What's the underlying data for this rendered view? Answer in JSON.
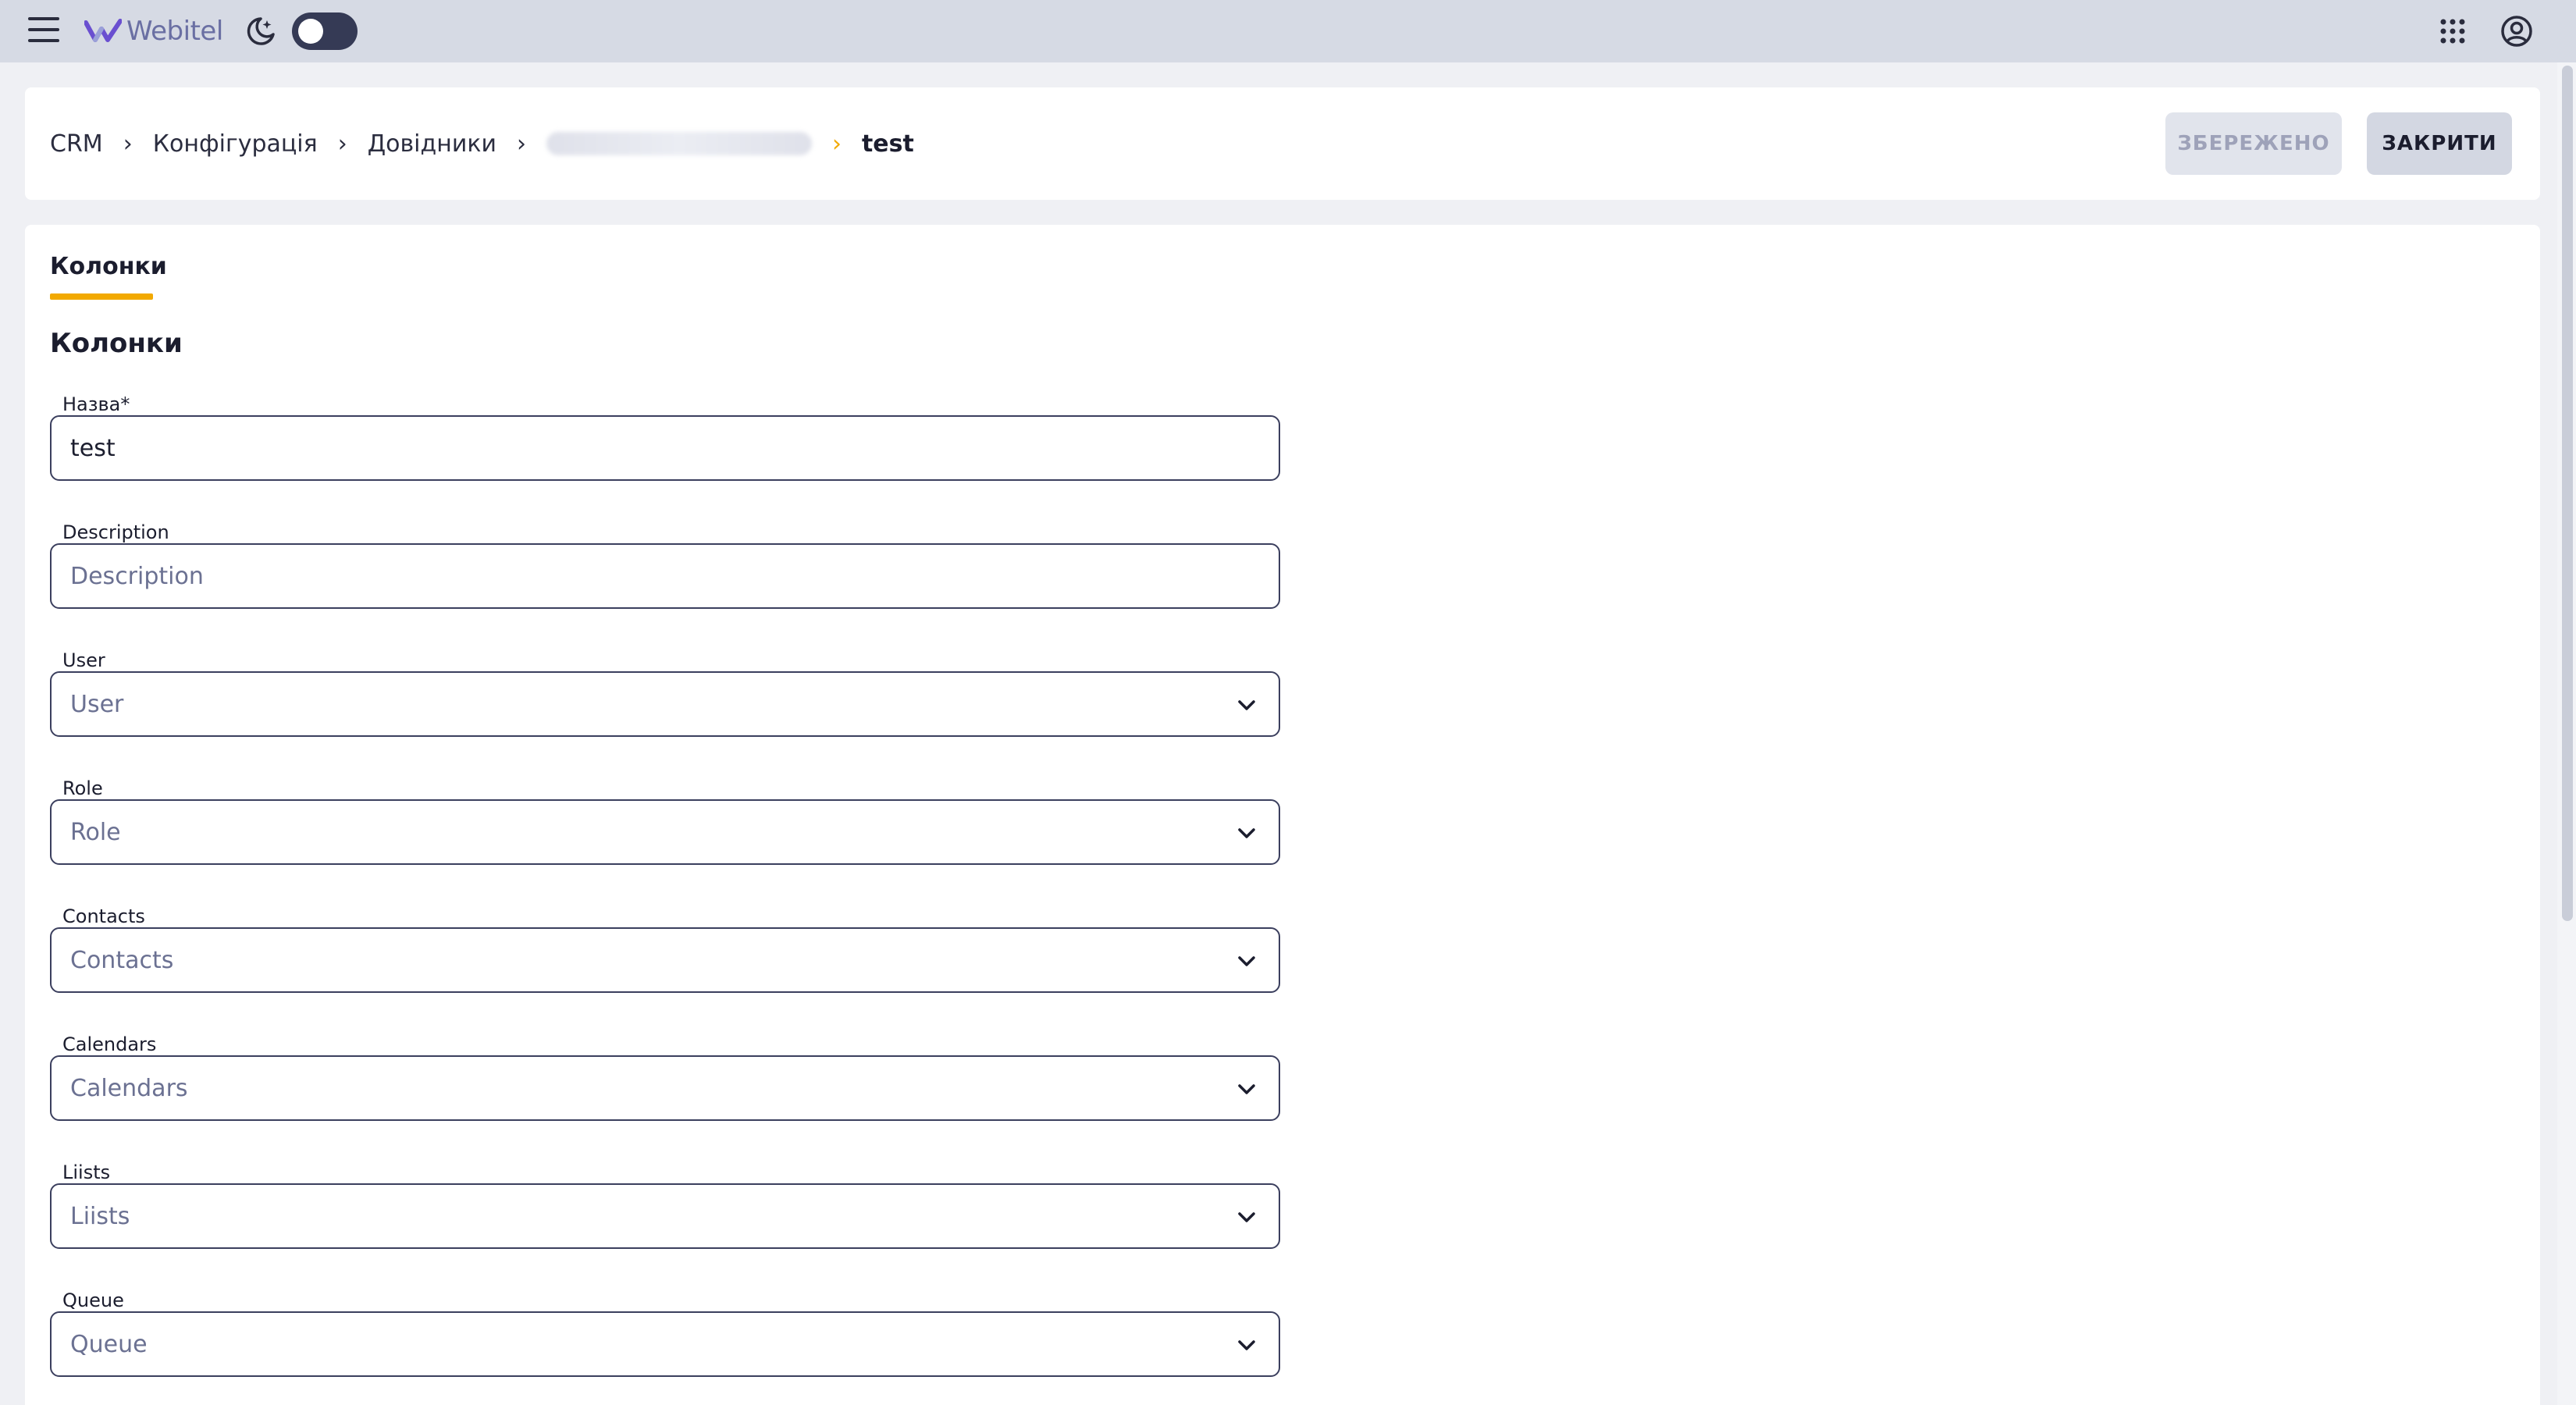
{
  "app": {
    "logo_text": "Webitel"
  },
  "breadcrumb": {
    "items": [
      "CRM",
      "Конфігурація",
      "Довідники"
    ],
    "current": "test"
  },
  "actions": {
    "saved_label": "ЗБЕРЕЖЕНО",
    "close_label": "ЗАКРИТИ"
  },
  "tabs": [
    {
      "label": "Колонки",
      "active": true
    }
  ],
  "section": {
    "title": "Колонки"
  },
  "form": {
    "fields": [
      {
        "label": "Назва*",
        "value": "test",
        "placeholder": "",
        "type": "input"
      },
      {
        "label": "Description",
        "value": "",
        "placeholder": "Description",
        "type": "input"
      },
      {
        "label": "User",
        "value": "",
        "placeholder": "User",
        "type": "select"
      },
      {
        "label": "Role",
        "value": "",
        "placeholder": "Role",
        "type": "select"
      },
      {
        "label": "Contacts",
        "value": "",
        "placeholder": "Contacts",
        "type": "select"
      },
      {
        "label": "Calendars",
        "value": "",
        "placeholder": "Calendars",
        "type": "select"
      },
      {
        "label": "Liists",
        "value": "",
        "placeholder": "Liists",
        "type": "select"
      },
      {
        "label": "Queue",
        "value": "",
        "placeholder": "Queue",
        "type": "select"
      }
    ]
  },
  "icons": {
    "menu": "hamburger-menu-icon",
    "theme": "moon-stars-icon",
    "apps": "apps-grid-icon",
    "account": "account-circle-icon",
    "select": "chevron-down-icon"
  },
  "colors": {
    "accent": "#f2a900",
    "appbar": "#d6dae4",
    "field_border": "#3b3f5e",
    "logo": "#6a6fa3"
  }
}
